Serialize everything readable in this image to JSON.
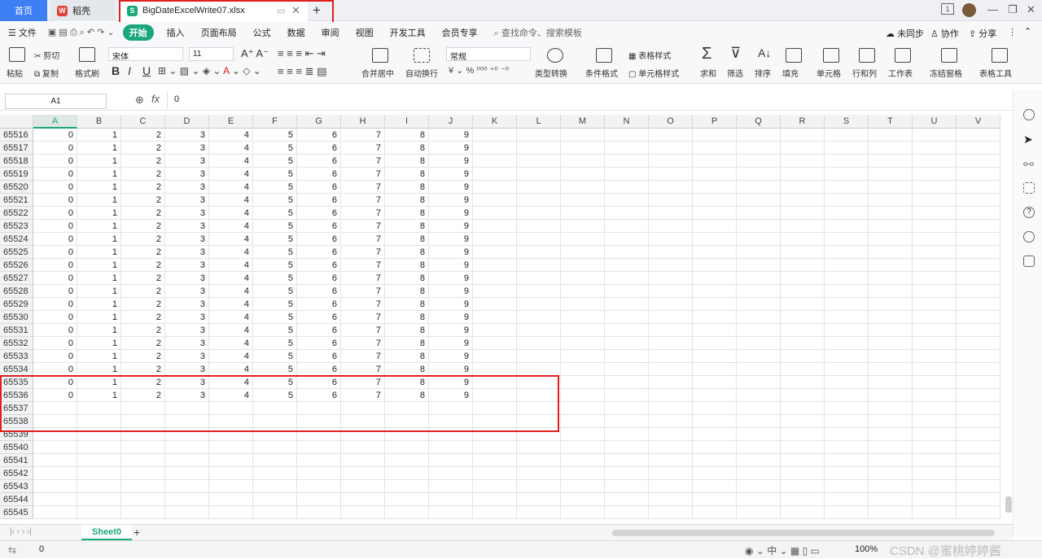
{
  "titlebar": {
    "tabs": [
      {
        "label": "首页",
        "icon": "home"
      },
      {
        "label": "稻壳",
        "icon": "daoke-logo-icon"
      },
      {
        "label": "BigDateExcelWrite07.xlsx",
        "icon": "spreadsheet-icon"
      }
    ],
    "new_tab": "+",
    "page_num": "1"
  },
  "menu": {
    "file": "文件",
    "items": [
      "开始",
      "插入",
      "页面布局",
      "公式",
      "数据",
      "审阅",
      "视图",
      "开发工具",
      "会员专享"
    ],
    "search_placeholder": "查找命令、搜索模板",
    "sync": "未同步",
    "collab": "协作",
    "share": "分享"
  },
  "ribbon": {
    "paste": "粘贴",
    "cut": "剪切",
    "copy": "复制",
    "format_painter": "格式刷",
    "font_name": "宋体",
    "font_size": "11",
    "bold": "B",
    "italic": "I",
    "underline": "U",
    "merge_center": "合并居中",
    "wrap_text": "自动换行",
    "number_format": "常规",
    "type_convert": "类型转换",
    "cond_format": "条件格式",
    "table_style": "表格样式",
    "cell_style": "单元格样式",
    "sum": "求和",
    "filter": "筛选",
    "sort": "排序",
    "fill": "填充",
    "cell": "单元格",
    "row_col": "行和列",
    "worksheet": "工作表",
    "freeze": "冻结窗格",
    "table_tools": "表格工具"
  },
  "formula_bar": {
    "name_box": "A1",
    "fx": "fx",
    "value": "0"
  },
  "grid": {
    "columns": [
      "A",
      "B",
      "C",
      "D",
      "E",
      "F",
      "G",
      "H",
      "I",
      "J",
      "K",
      "L",
      "M",
      "N",
      "O",
      "P",
      "Q",
      "R",
      "S",
      "T",
      "U",
      "V"
    ],
    "rows": [
      "65516",
      "65517",
      "65518",
      "65519",
      "65520",
      "65521",
      "65522",
      "65523",
      "65524",
      "65525",
      "65526",
      "65527",
      "65528",
      "65529",
      "65530",
      "65531",
      "65532",
      "65533",
      "65534",
      "65535",
      "65536",
      "65537",
      "65538",
      "65539",
      "65540",
      "65541",
      "65542",
      "65543",
      "65544",
      "65545"
    ],
    "filled_rows": 21,
    "values": [
      "0",
      "1",
      "2",
      "3",
      "4",
      "5",
      "6",
      "7",
      "8",
      "9"
    ]
  },
  "sheets": {
    "active": "Sheet0",
    "add": "+"
  },
  "status": {
    "value": "0",
    "zoom": "100%",
    "watermark": "CSDN @蜜桃婷婷酱"
  },
  "colors": {
    "accent": "#1aa77b",
    "highlight": "#e02020",
    "home_tab": "#3d7ef4"
  }
}
